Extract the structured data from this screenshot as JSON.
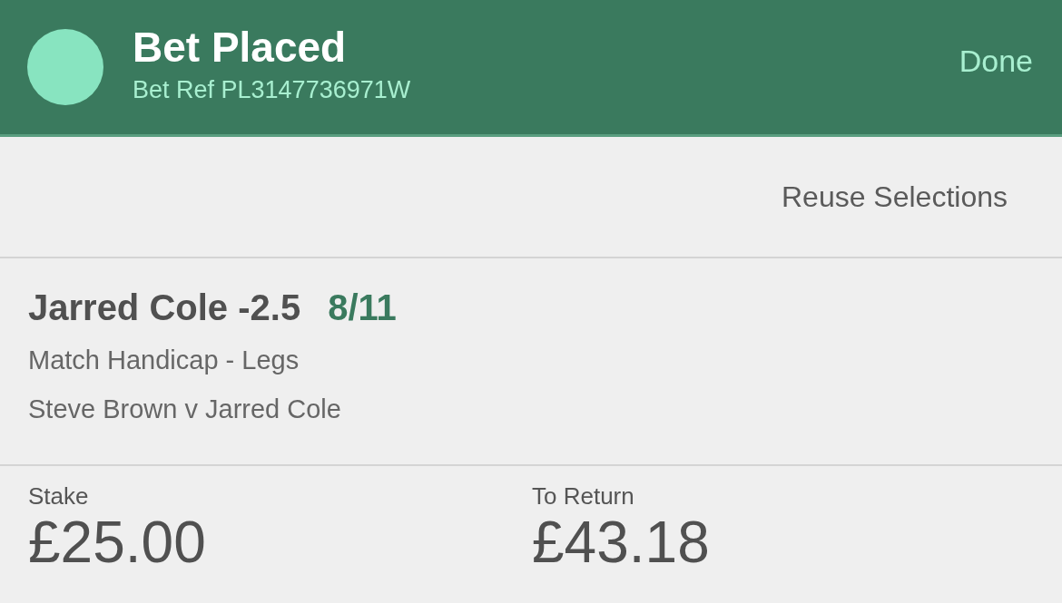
{
  "header": {
    "title": "Bet Placed",
    "bet_ref": "Bet Ref PL3147736971W",
    "done_button": "Done"
  },
  "reuse_button": "Reuse Selections",
  "selection": {
    "name": "Jarred Cole -2.5",
    "odds": "8/11",
    "market": "Match Handicap - Legs",
    "event": "Steve Brown v Jarred Cole"
  },
  "totals": [
    {
      "label": "Stake",
      "value": "£25.00"
    },
    {
      "label": "To Return",
      "value": "£43.18"
    }
  ]
}
